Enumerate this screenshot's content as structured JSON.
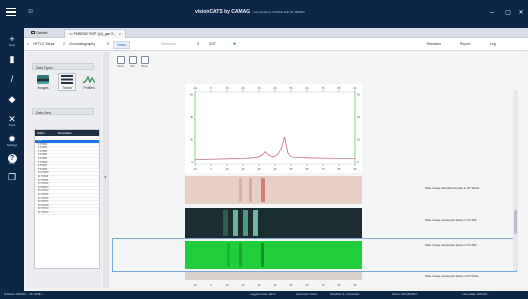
{
  "titlebar": {
    "app_short": "SI",
    "window_title": "visionCATS by CAMAG",
    "window_subtitle": "- Connected to CAMAG with ID: 380001",
    "min_label": "–",
    "max_label": "▢",
    "close_label": "✕"
  },
  "rail": [
    {
      "icon": "plus-icon",
      "glyph": "+",
      "label": "New"
    },
    {
      "icon": "document-icon",
      "glyph": "▮",
      "label": ""
    },
    {
      "icon": "pen-icon",
      "glyph": "/",
      "label": ""
    },
    {
      "icon": "tag-icon",
      "glyph": "◆",
      "label": ""
    },
    {
      "icon": "tools-icon",
      "glyph": "✕",
      "label": "Tools"
    },
    {
      "icon": "gear-icon",
      "glyph": "✹",
      "label": "Settings"
    },
    {
      "icon": "help-icon",
      "glyph": "?",
      "label": "Help"
    },
    {
      "icon": "copy-icon",
      "glyph": "❐",
      "label": ""
    }
  ],
  "tabs": [
    {
      "label": "Cabinet"
    },
    {
      "label": "== PHBR367 SOP 1(1)_gen S..."
    }
  ],
  "nav": {
    "step1_num": "1",
    "step1": "HPTLC Steps",
    "step2_num": "2",
    "step2": "Chromatography",
    "step3_num": "3",
    "step3": "Video",
    "step4": "Detection",
    "step5_num": "5",
    "step5": "SST",
    "remarks": "Remarks",
    "report": "Report",
    "log": "Log"
  },
  "left_panel": {
    "data_types_header": "Data Types",
    "types": [
      "Images",
      "Tracks",
      "Profiles"
    ],
    "data_view_header": "Data View",
    "grid_cols": [
      "Id/Ref",
      "Description"
    ],
    "rows": [
      "1  1",
      "2  STD01",
      "3  STD02",
      "4  STD03",
      "5  STD04",
      "6  STD05",
      "7  STD06",
      "8  STD07",
      "9  STD08",
      "10 STD09",
      "11 STD10",
      "12 STD11",
      "13 STD12",
      "14 STD13",
      "15 STD14",
      "16 STD15",
      "17 STD16",
      "18 STD17",
      "19 STD18",
      "20 STD19",
      "21 STD20"
    ]
  },
  "toolbar": [
    "Zoom",
    "Pan",
    "Reset"
  ],
  "chart_data": {
    "type": "line",
    "x_ticks": [
      "-10",
      "0",
      "10",
      "20",
      "30",
      "40",
      "50",
      "60",
      "70",
      "80",
      "90"
    ],
    "y_ticks": [
      "60",
      "40",
      "20",
      "0"
    ],
    "ylim": [
      -2,
      62
    ],
    "xlim": [
      -10,
      90
    ],
    "series": [
      {
        "color": "#c0707a",
        "x": [
          -10,
          0,
          10,
          20,
          25,
          28,
          30,
          32,
          34,
          36,
          38,
          40,
          42,
          44,
          46,
          48,
          50,
          52,
          54,
          58,
          62,
          70,
          80,
          90
        ],
        "y": [
          2,
          2.2,
          2.6,
          3,
          3.4,
          3.8,
          4.5,
          6,
          9,
          6,
          4.5,
          5,
          7,
          12,
          22,
          8,
          4.5,
          4,
          3.8,
          3.6,
          3.4,
          3.2,
          3,
          3
        ]
      }
    ]
  },
  "tracks": [
    {
      "label": "Take image derivatized plate in RT White"
    },
    {
      "label": "Take image developed plate in UV 366"
    },
    {
      "label": "Take image developed plate in UV 254"
    },
    {
      "label": "Take image developed plate in RT White"
    }
  ],
  "statusbar": {
    "left": "Finished • 2023-02-... 16 / 2019-1 ...",
    "mid1": "Logged in user: admin",
    "mid2": "Instrument: Online",
    "mid3": "Visualizer: 3 • Connected",
    "right1": "Server: 192.168.000.1",
    "right2": "Last update: 2019-08-..."
  }
}
